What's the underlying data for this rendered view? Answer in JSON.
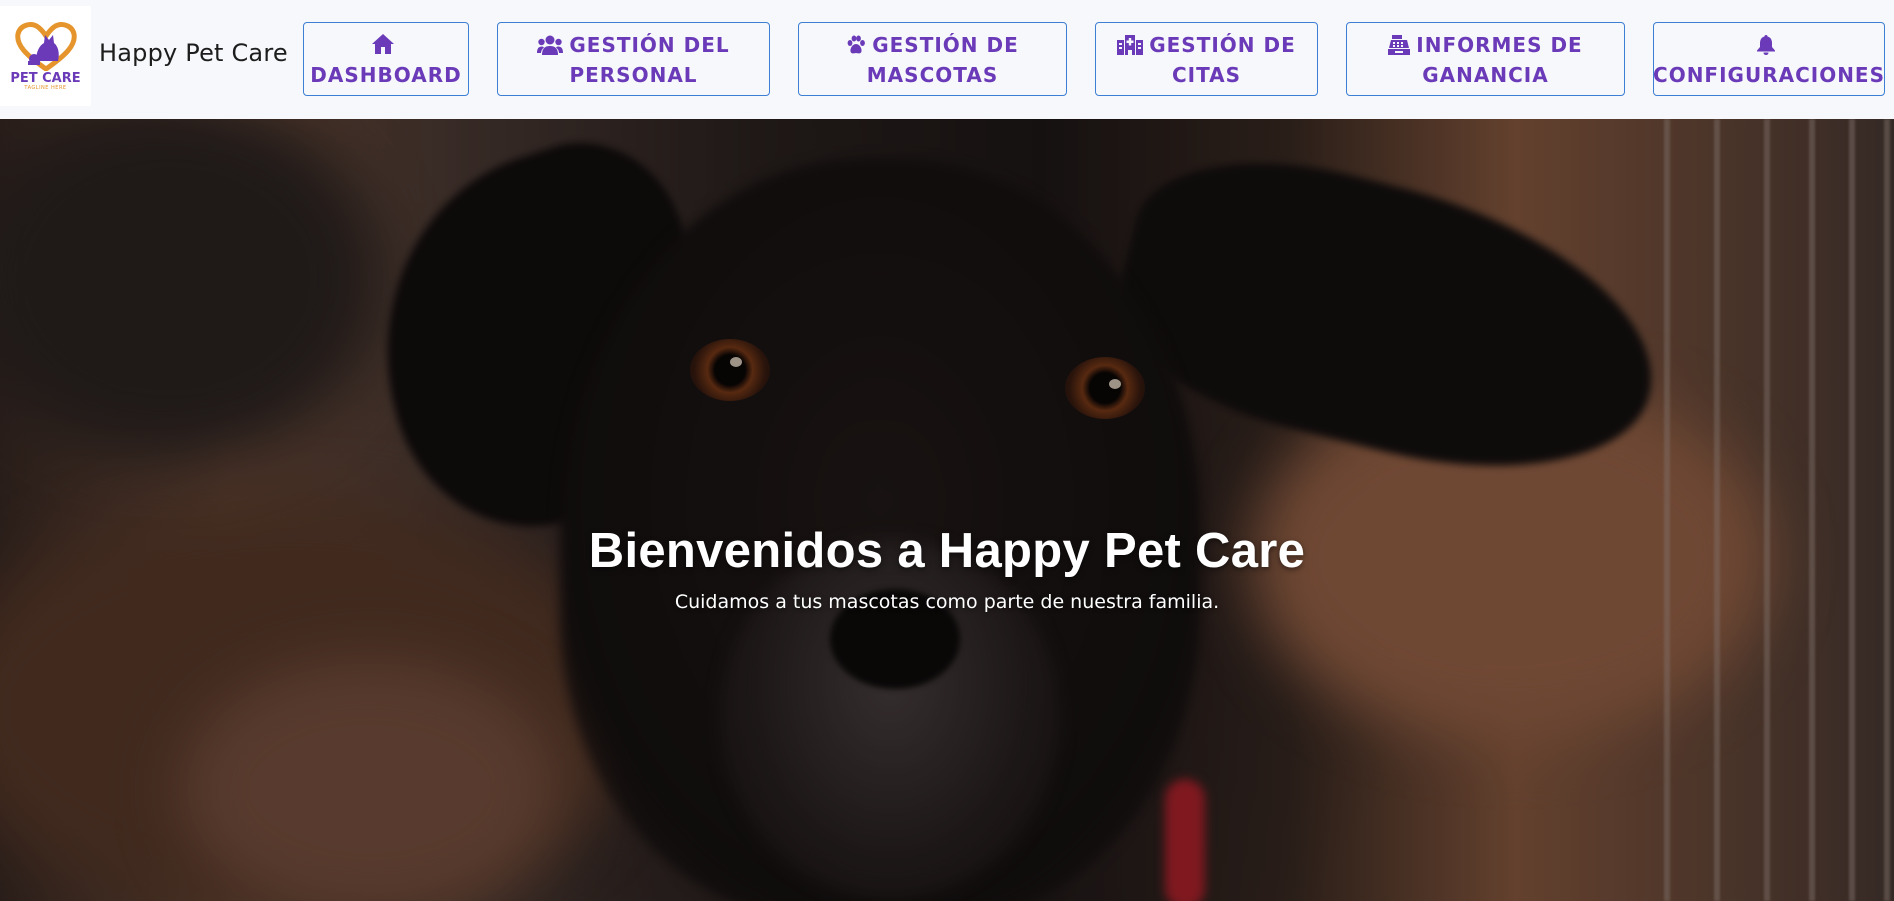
{
  "brand": {
    "logo_title": "PET CARE",
    "logo_tagline": "TAGLINE HERE",
    "name": "Happy Pet Care"
  },
  "nav": [
    {
      "id": "dashboard",
      "icon": "home-icon",
      "lines": [
        "DASHBOARD"
      ]
    },
    {
      "id": "personal",
      "icon": "users-icon",
      "lines": [
        "GESTIÓN DEL",
        "PERSONAL"
      ]
    },
    {
      "id": "mascotas",
      "icon": "paw-icon",
      "lines": [
        "GESTIÓN DE",
        "MASCOTAS"
      ]
    },
    {
      "id": "citas",
      "icon": "hospital-icon",
      "lines": [
        "GESTIÓN DE",
        "CITAS"
      ]
    },
    {
      "id": "ganancia",
      "icon": "cash-register-icon",
      "lines": [
        "INFORMES DE",
        "GANANCIA"
      ]
    },
    {
      "id": "config",
      "icon": "bell-icon",
      "lines": [
        "CONFIGURACIONES"
      ]
    }
  ],
  "hero": {
    "title": "Bienvenidos a Happy Pet Care",
    "subtitle": "Cuidamos a tus mascotas como parte de nuestra familia."
  },
  "colors": {
    "accent": "#6a3ab8",
    "nav_border": "#3e7fd6",
    "navbar_bg": "#f6f8fb",
    "logo_orange": "#e5952b"
  }
}
